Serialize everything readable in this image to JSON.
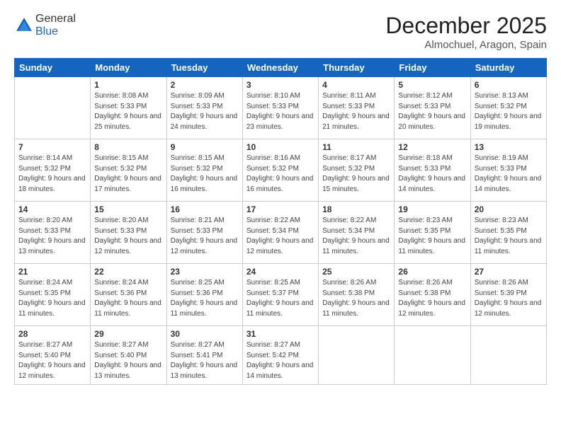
{
  "header": {
    "logo_general": "General",
    "logo_blue": "Blue",
    "month": "December 2025",
    "location": "Almochuel, Aragon, Spain"
  },
  "weekdays": [
    "Sunday",
    "Monday",
    "Tuesday",
    "Wednesday",
    "Thursday",
    "Friday",
    "Saturday"
  ],
  "weeks": [
    [
      {
        "day": "",
        "sunrise": "",
        "sunset": "",
        "daylight": ""
      },
      {
        "day": "1",
        "sunrise": "Sunrise: 8:08 AM",
        "sunset": "Sunset: 5:33 PM",
        "daylight": "Daylight: 9 hours and 25 minutes."
      },
      {
        "day": "2",
        "sunrise": "Sunrise: 8:09 AM",
        "sunset": "Sunset: 5:33 PM",
        "daylight": "Daylight: 9 hours and 24 minutes."
      },
      {
        "day": "3",
        "sunrise": "Sunrise: 8:10 AM",
        "sunset": "Sunset: 5:33 PM",
        "daylight": "Daylight: 9 hours and 23 minutes."
      },
      {
        "day": "4",
        "sunrise": "Sunrise: 8:11 AM",
        "sunset": "Sunset: 5:33 PM",
        "daylight": "Daylight: 9 hours and 21 minutes."
      },
      {
        "day": "5",
        "sunrise": "Sunrise: 8:12 AM",
        "sunset": "Sunset: 5:33 PM",
        "daylight": "Daylight: 9 hours and 20 minutes."
      },
      {
        "day": "6",
        "sunrise": "Sunrise: 8:13 AM",
        "sunset": "Sunset: 5:32 PM",
        "daylight": "Daylight: 9 hours and 19 minutes."
      }
    ],
    [
      {
        "day": "7",
        "sunrise": "Sunrise: 8:14 AM",
        "sunset": "Sunset: 5:32 PM",
        "daylight": "Daylight: 9 hours and 18 minutes."
      },
      {
        "day": "8",
        "sunrise": "Sunrise: 8:15 AM",
        "sunset": "Sunset: 5:32 PM",
        "daylight": "Daylight: 9 hours and 17 minutes."
      },
      {
        "day": "9",
        "sunrise": "Sunrise: 8:15 AM",
        "sunset": "Sunset: 5:32 PM",
        "daylight": "Daylight: 9 hours and 16 minutes."
      },
      {
        "day": "10",
        "sunrise": "Sunrise: 8:16 AM",
        "sunset": "Sunset: 5:32 PM",
        "daylight": "Daylight: 9 hours and 16 minutes."
      },
      {
        "day": "11",
        "sunrise": "Sunrise: 8:17 AM",
        "sunset": "Sunset: 5:32 PM",
        "daylight": "Daylight: 9 hours and 15 minutes."
      },
      {
        "day": "12",
        "sunrise": "Sunrise: 8:18 AM",
        "sunset": "Sunset: 5:33 PM",
        "daylight": "Daylight: 9 hours and 14 minutes."
      },
      {
        "day": "13",
        "sunrise": "Sunrise: 8:19 AM",
        "sunset": "Sunset: 5:33 PM",
        "daylight": "Daylight: 9 hours and 14 minutes."
      }
    ],
    [
      {
        "day": "14",
        "sunrise": "Sunrise: 8:20 AM",
        "sunset": "Sunset: 5:33 PM",
        "daylight": "Daylight: 9 hours and 13 minutes."
      },
      {
        "day": "15",
        "sunrise": "Sunrise: 8:20 AM",
        "sunset": "Sunset: 5:33 PM",
        "daylight": "Daylight: 9 hours and 12 minutes."
      },
      {
        "day": "16",
        "sunrise": "Sunrise: 8:21 AM",
        "sunset": "Sunset: 5:33 PM",
        "daylight": "Daylight: 9 hours and 12 minutes."
      },
      {
        "day": "17",
        "sunrise": "Sunrise: 8:22 AM",
        "sunset": "Sunset: 5:34 PM",
        "daylight": "Daylight: 9 hours and 12 minutes."
      },
      {
        "day": "18",
        "sunrise": "Sunrise: 8:22 AM",
        "sunset": "Sunset: 5:34 PM",
        "daylight": "Daylight: 9 hours and 11 minutes."
      },
      {
        "day": "19",
        "sunrise": "Sunrise: 8:23 AM",
        "sunset": "Sunset: 5:35 PM",
        "daylight": "Daylight: 9 hours and 11 minutes."
      },
      {
        "day": "20",
        "sunrise": "Sunrise: 8:23 AM",
        "sunset": "Sunset: 5:35 PM",
        "daylight": "Daylight: 9 hours and 11 minutes."
      }
    ],
    [
      {
        "day": "21",
        "sunrise": "Sunrise: 8:24 AM",
        "sunset": "Sunset: 5:35 PM",
        "daylight": "Daylight: 9 hours and 11 minutes."
      },
      {
        "day": "22",
        "sunrise": "Sunrise: 8:24 AM",
        "sunset": "Sunset: 5:36 PM",
        "daylight": "Daylight: 9 hours and 11 minutes."
      },
      {
        "day": "23",
        "sunrise": "Sunrise: 8:25 AM",
        "sunset": "Sunset: 5:36 PM",
        "daylight": "Daylight: 9 hours and 11 minutes."
      },
      {
        "day": "24",
        "sunrise": "Sunrise: 8:25 AM",
        "sunset": "Sunset: 5:37 PM",
        "daylight": "Daylight: 9 hours and 11 minutes."
      },
      {
        "day": "25",
        "sunrise": "Sunrise: 8:26 AM",
        "sunset": "Sunset: 5:38 PM",
        "daylight": "Daylight: 9 hours and 11 minutes."
      },
      {
        "day": "26",
        "sunrise": "Sunrise: 8:26 AM",
        "sunset": "Sunset: 5:38 PM",
        "daylight": "Daylight: 9 hours and 12 minutes."
      },
      {
        "day": "27",
        "sunrise": "Sunrise: 8:26 AM",
        "sunset": "Sunset: 5:39 PM",
        "daylight": "Daylight: 9 hours and 12 minutes."
      }
    ],
    [
      {
        "day": "28",
        "sunrise": "Sunrise: 8:27 AM",
        "sunset": "Sunset: 5:40 PM",
        "daylight": "Daylight: 9 hours and 12 minutes."
      },
      {
        "day": "29",
        "sunrise": "Sunrise: 8:27 AM",
        "sunset": "Sunset: 5:40 PM",
        "daylight": "Daylight: 9 hours and 13 minutes."
      },
      {
        "day": "30",
        "sunrise": "Sunrise: 8:27 AM",
        "sunset": "Sunset: 5:41 PM",
        "daylight": "Daylight: 9 hours and 13 minutes."
      },
      {
        "day": "31",
        "sunrise": "Sunrise: 8:27 AM",
        "sunset": "Sunset: 5:42 PM",
        "daylight": "Daylight: 9 hours and 14 minutes."
      },
      {
        "day": "",
        "sunrise": "",
        "sunset": "",
        "daylight": ""
      },
      {
        "day": "",
        "sunrise": "",
        "sunset": "",
        "daylight": ""
      },
      {
        "day": "",
        "sunrise": "",
        "sunset": "",
        "daylight": ""
      }
    ]
  ]
}
